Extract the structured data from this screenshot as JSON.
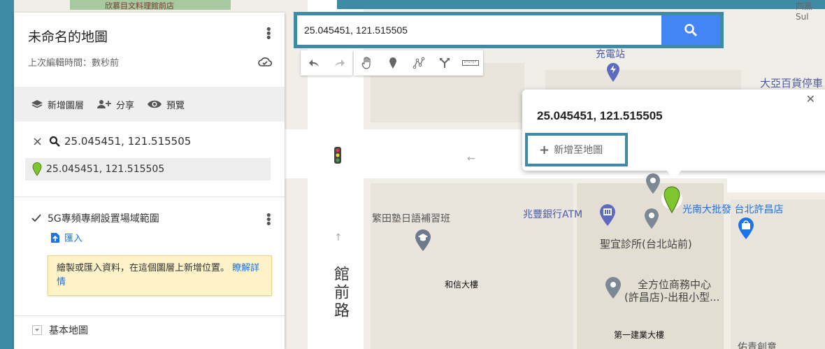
{
  "panel": {
    "map_title": "未命名的地圖",
    "map_subtitle": "上次編輯時間：數秒前",
    "toolbar": {
      "add_layer": "新增圖層",
      "share": "分享",
      "preview": "預覽"
    },
    "search": {
      "query": "25.045451, 121.515505",
      "result": "25.045451, 121.515505"
    },
    "layer": {
      "name": "5G專頻專網設置場域範圍",
      "import_label": "匯入",
      "tip_text": "繪製或匯入資料，在這個圖層上新增位置。",
      "tip_link": "瞭解詳情"
    },
    "base_map_label": "基本地圖"
  },
  "searchbox": {
    "value": "25.045451, 121.515505"
  },
  "popup": {
    "coords": "25.045451, 121.515505",
    "add_label": "新增至地圖"
  },
  "map": {
    "labels": {
      "charging": "充電站",
      "daya": "大亞百貨停車",
      "cram_school": "繁田塾日語補習班",
      "atm": "兆豐銀行ATM",
      "store": "光南大批發 台北許昌店",
      "clinic": "聖宜診所(台北站前)",
      "hexin": "和信大樓",
      "business_center_1": "全方位商務中心",
      "business_center_2": "(許昌店)-出租小型...",
      "road_name": "館前路",
      "diyi": "第一建業大樓",
      "bottom_right": "佑青創意",
      "top_left": "欣慕目文料理館前店",
      "top_right": "四蒸Sul"
    }
  },
  "colors": {
    "accent_frame": "#3f8aa4",
    "search_button": "#4285f4",
    "pin_green": "#7dc62e",
    "poi_blue": "#5c6bc0"
  }
}
